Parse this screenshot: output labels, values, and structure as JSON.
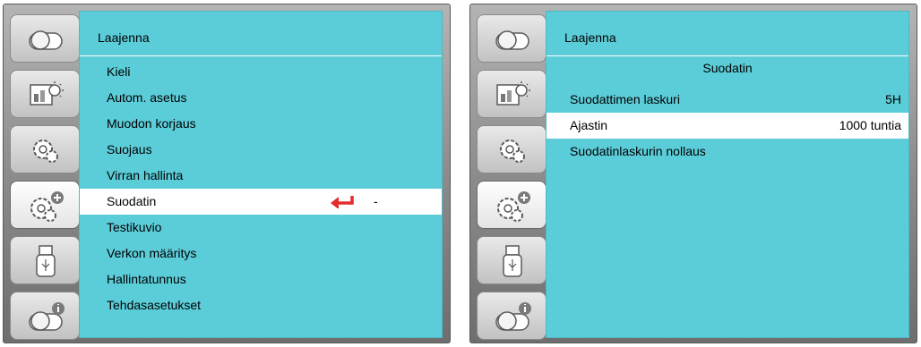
{
  "left_panel": {
    "header": "Laajenna",
    "menu": [
      {
        "label": "Kieli"
      },
      {
        "label": "Autom. asetus"
      },
      {
        "label": "Muodon korjaus"
      },
      {
        "label": "Suojaus"
      },
      {
        "label": "Virran hallinta"
      },
      {
        "label": "Suodatin",
        "value": "-"
      },
      {
        "label": "Testikuvio"
      },
      {
        "label": "Verkon määritys"
      },
      {
        "label": "Hallintatunnus"
      },
      {
        "label": "Tehdasasetukset"
      }
    ],
    "selected_index": 5
  },
  "right_panel": {
    "header": "Laajenna",
    "title": "Suodatin",
    "rows": [
      {
        "label": "Suodattimen laskuri",
        "value": "5H"
      },
      {
        "label": "Ajastin",
        "value": "1000 tuntia"
      },
      {
        "label": "Suodatinlaskurin nollaus"
      }
    ],
    "selected_index": 1
  },
  "sidebar_tabs": [
    {
      "icon": "projector-icon"
    },
    {
      "icon": "display-brightness-icon"
    },
    {
      "icon": "settings-gear-icon"
    },
    {
      "icon": "advanced-settings-gear-plus-icon"
    },
    {
      "icon": "usb-drive-icon"
    },
    {
      "icon": "info-projector-icon"
    }
  ],
  "active_tab_index": 3,
  "colors": {
    "content_bg": "#5bcdd9",
    "selected_row_bg": "#ffffff",
    "enter_arrow": "#e52b2b"
  }
}
